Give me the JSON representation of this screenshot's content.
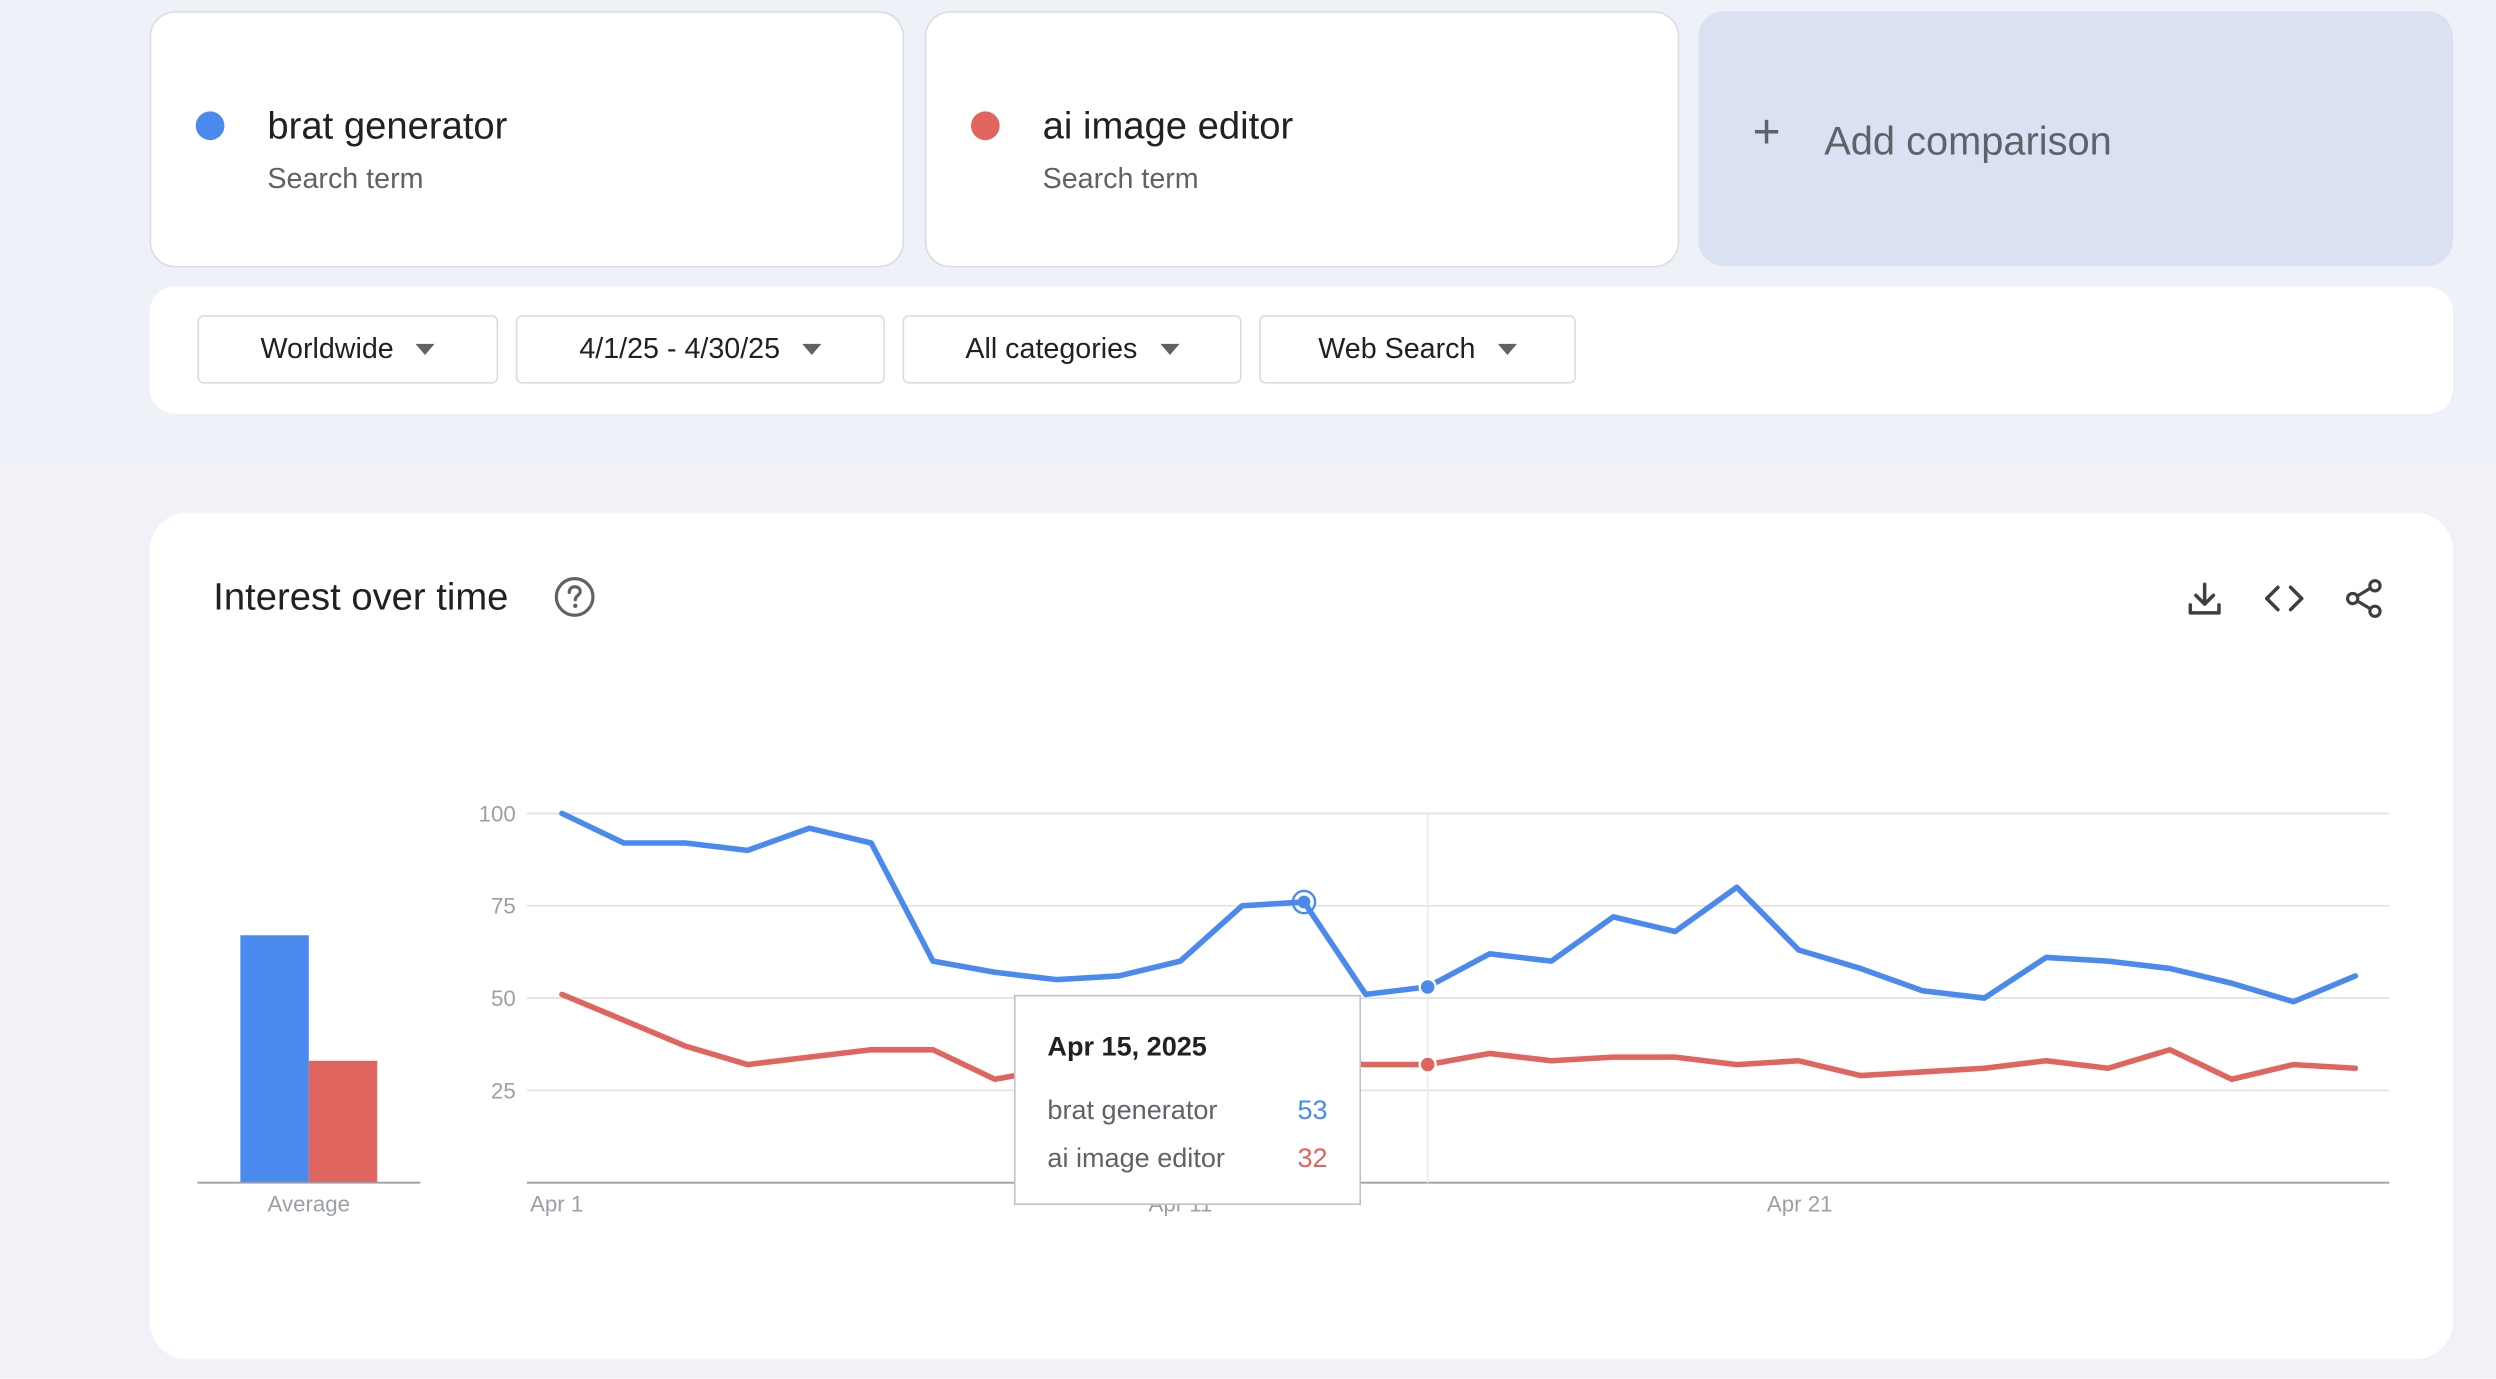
{
  "terms": [
    {
      "name": "brat generator",
      "subtitle": "Search term",
      "color": "#4a89ee"
    },
    {
      "name": "ai image editor",
      "subtitle": "Search term",
      "color": "#e0655e"
    }
  ],
  "add_comparison": {
    "label": "Add comparison",
    "icon": "plus-icon"
  },
  "filters": [
    {
      "label": "Worldwide"
    },
    {
      "label": "4/1/25 - 4/30/25"
    },
    {
      "label": "All categories"
    },
    {
      "label": "Web Search"
    }
  ],
  "chart_panel": {
    "title": "Interest over time",
    "help_icon": "help-circle-icon",
    "actions": [
      "download-icon",
      "embed-code-icon",
      "share-icon"
    ]
  },
  "tooltip": {
    "date": "Apr 15, 2025",
    "rows": [
      {
        "name": "brat generator",
        "value": "53"
      },
      {
        "name": "ai image editor",
        "value": "32"
      }
    ]
  },
  "chart_data": {
    "type": "line",
    "x": [
      "Apr 1",
      "Apr 2",
      "Apr 3",
      "Apr 4",
      "Apr 5",
      "Apr 6",
      "Apr 7",
      "Apr 8",
      "Apr 9",
      "Apr 10",
      "Apr 11",
      "Apr 12",
      "Apr 13",
      "Apr 14",
      "Apr 15",
      "Apr 16",
      "Apr 17",
      "Apr 18",
      "Apr 19",
      "Apr 20",
      "Apr 21",
      "Apr 22",
      "Apr 23",
      "Apr 24",
      "Apr 25",
      "Apr 26",
      "Apr 27",
      "Apr 28",
      "Apr 29",
      "Apr 30"
    ],
    "series": [
      {
        "name": "brat generator",
        "color": "#4a89ee",
        "values": [
          100,
          92,
          92,
          90,
          96,
          92,
          60,
          57,
          55,
          56,
          60,
          75,
          76,
          51,
          53,
          62,
          60,
          72,
          68,
          80,
          63,
          58,
          52,
          50,
          61,
          60,
          58,
          54,
          49,
          56
        ]
      },
      {
        "name": "ai image editor",
        "color": "#e0655e",
        "values": [
          51,
          44,
          37,
          32,
          34,
          36,
          36,
          28,
          31,
          31,
          30,
          34,
          33,
          32,
          32,
          35,
          33,
          34,
          34,
          32,
          33,
          29,
          30,
          31,
          33,
          31,
          36,
          28,
          32,
          31
        ]
      }
    ],
    "y_ticks": [
      100,
      75,
      50,
      25
    ],
    "x_tick_labels": [
      "Apr 1",
      "Apr 11",
      "Apr 21"
    ],
    "ylim": [
      0,
      100
    ],
    "highlighted_date": "Apr 15",
    "average": {
      "label": "Average",
      "values": [
        67,
        33
      ]
    },
    "grid": true
  }
}
